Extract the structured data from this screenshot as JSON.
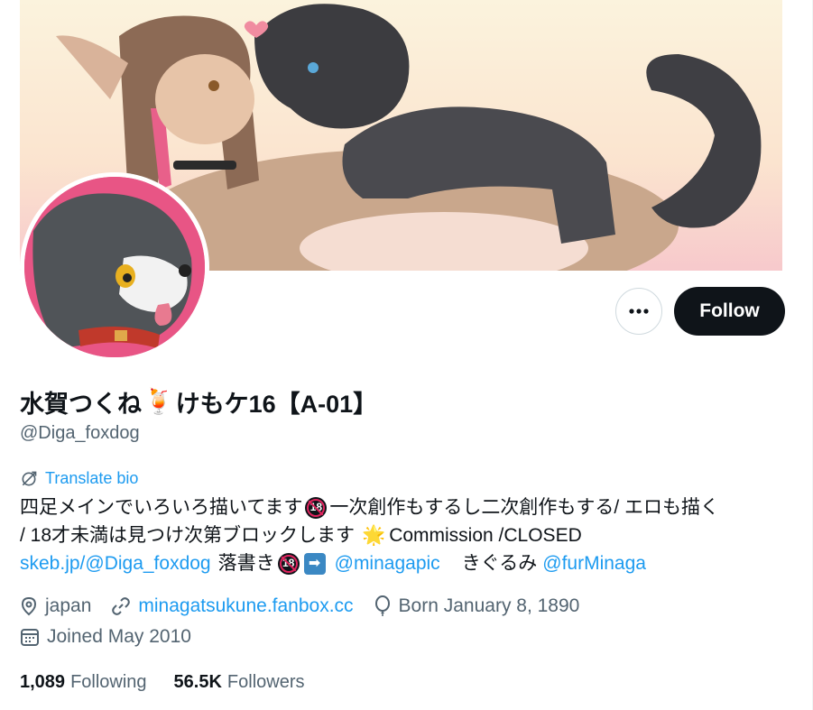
{
  "profile": {
    "display_name_part1": "水賀つくね",
    "display_name_emoji": "🍹",
    "display_name_part2": "けもケ16【A-01】",
    "handle": "@Diga_foxdog"
  },
  "actions": {
    "more_icon": "more-horizontal-icon",
    "follow_label": "Follow"
  },
  "translate": {
    "label": "Translate bio",
    "icon": "translate-icon"
  },
  "bio": {
    "line1_a": "四足メインでいろいろ描いてます",
    "badge_18": "18",
    "line1_b": "一次創作もするし二次創作もする/ エロも描く",
    "line2_a": "/ 18才未満は見つけ次第ブロックします",
    "star_emoji": "🌟",
    "line2_b": "Commission /CLOSED",
    "link_skeb": "skeb.jp/@Diga_foxdog",
    "line3_a": "落書き",
    "arrow": "➡",
    "link_minagapic": "@minagapic",
    "line3_b": "きぐるみ",
    "link_furminaga": "@furMinaga"
  },
  "meta": {
    "location": "japan",
    "website": "minagatsukune.fanbox.cc",
    "birthday": "Born January 8, 1890",
    "joined": "Joined May 2010",
    "icons": {
      "location": "location-pin-icon",
      "website": "link-icon",
      "birthday": "balloon-icon",
      "joined": "calendar-icon"
    }
  },
  "stats": {
    "following_count": "1,089",
    "following_label": "Following",
    "followers_count": "56.5K",
    "followers_label": "Followers"
  },
  "colors": {
    "accent": "#1d9bf0",
    "text_primary": "#0f1419",
    "text_secondary": "#536471",
    "follow_bg": "#0f1419",
    "avatar_bg": "#e85585"
  }
}
